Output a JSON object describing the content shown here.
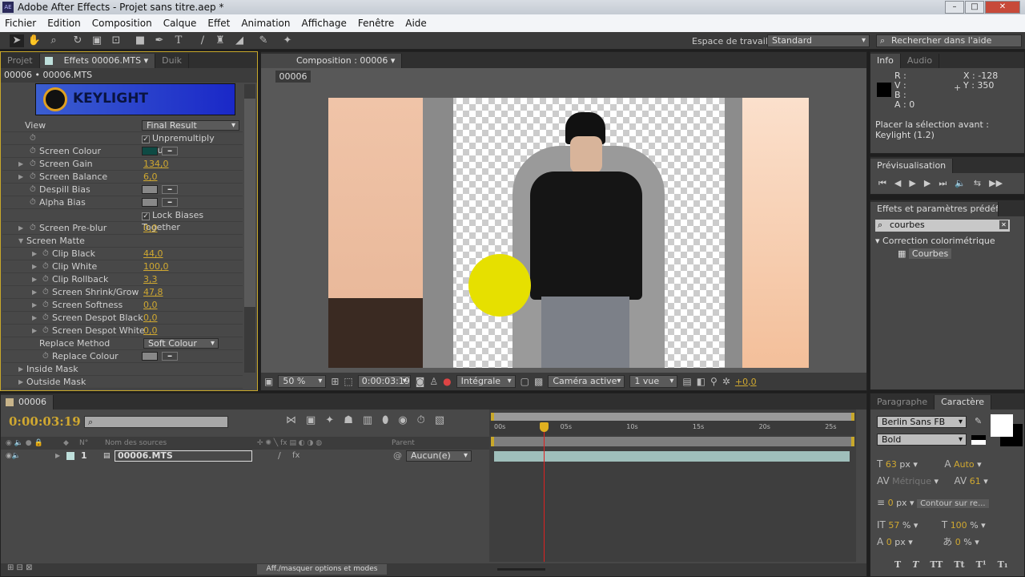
{
  "window": {
    "title": "Adobe After Effects - Projet sans titre.aep *",
    "icon": "AE"
  },
  "menu": [
    "Fichier",
    "Edition",
    "Composition",
    "Calque",
    "Effet",
    "Animation",
    "Affichage",
    "Fenêtre",
    "Aide"
  ],
  "toolbar": {
    "workspace_label": "Espace de travail :",
    "workspace_value": "Standard",
    "search_placeholder": "Rechercher dans l'aide"
  },
  "effects_panel": {
    "tabs": [
      "Projet",
      "Effets 00006.MTS",
      "Duik"
    ],
    "breadcrumb": "00006 • 00006.MTS",
    "logo": "KEYLIGHT",
    "view_label": "View",
    "view_value": "Final Result",
    "unpremultiply": "Unpremultiply Result",
    "rows": [
      {
        "label": "Screen Colour",
        "type": "color",
        "color": "#0e4a44"
      },
      {
        "label": "Screen Gain",
        "value": "134,0"
      },
      {
        "label": "Screen Balance",
        "value": "6,0"
      },
      {
        "label": "Despill Bias",
        "type": "color",
        "color": "#888888"
      },
      {
        "label": "Alpha Bias",
        "type": "color",
        "color": "#888888"
      }
    ],
    "lock_biases": "Lock Biases Together",
    "pre_blur": {
      "label": "Screen Pre-blur",
      "value": "0,0"
    },
    "screen_matte": "Screen Matte",
    "matte_rows": [
      {
        "label": "Clip Black",
        "value": "44,0"
      },
      {
        "label": "Clip White",
        "value": "100,0"
      },
      {
        "label": "Clip Rollback",
        "value": "3,3"
      },
      {
        "label": "Screen Shrink/Grow",
        "value": "47,8"
      },
      {
        "label": "Screen Softness",
        "value": "0,0"
      },
      {
        "label": "Screen Despot Black",
        "value": "0,0"
      },
      {
        "label": "Screen Despot White",
        "value": "0,0"
      }
    ],
    "replace_method_label": "Replace Method",
    "replace_method_value": "Soft Colour",
    "replace_colour": "Replace Colour",
    "inside_mask": "Inside Mask",
    "outside_mask": "Outside Mask"
  },
  "composition": {
    "tab": "Composition : 00006",
    "crumb": "00006",
    "zoom": "50 %",
    "timecode": "0:00:03:19",
    "resolution": "Intégrale",
    "camera": "Caméra active",
    "views": "1 vue",
    "exposure": "+0,0"
  },
  "info": {
    "tabs": [
      "Info",
      "Audio"
    ],
    "r": "R :",
    "v": "V :",
    "b": "B :",
    "a": "A : 0",
    "x": "X : -128",
    "y": "Y : 350",
    "message1": "Placer la sélection avant :",
    "message2": "Keylight (1.2)"
  },
  "preview": {
    "tab": "Prévisualisation"
  },
  "effects_presets": {
    "tab": "Effets et paramètres prédéfinis",
    "search": "courbes",
    "category": "Correction colorimétrique",
    "item": "Courbes"
  },
  "character": {
    "tabs": [
      "Paragraphe",
      "Caractère"
    ],
    "font": "Berlin Sans FB",
    "style": "Bold",
    "size": "63",
    "size_unit": "px",
    "leading": "Auto",
    "kerning": "Métrique",
    "tracking": "61",
    "stroke": "0",
    "stroke_unit": "px",
    "stroke_mode": "Contour sur re...",
    "vscale": "57",
    "hscale": "100",
    "baseline": "0",
    "tsume": "0",
    "pct": "%"
  },
  "timeline": {
    "tab": "00006",
    "timecode": "0:00:03:19",
    "columns": {
      "number": "N°",
      "source": "Nom des sources",
      "parent": "Parent"
    },
    "layers": [
      {
        "number": "1",
        "name": "00006.MTS",
        "parent": "Aucun(e)"
      }
    ],
    "ruler": [
      "00s",
      "05s",
      "10s",
      "15s",
      "20s",
      "25s"
    ],
    "current_time_s": 3.76,
    "footer": "Aff./masquer options et modes"
  }
}
